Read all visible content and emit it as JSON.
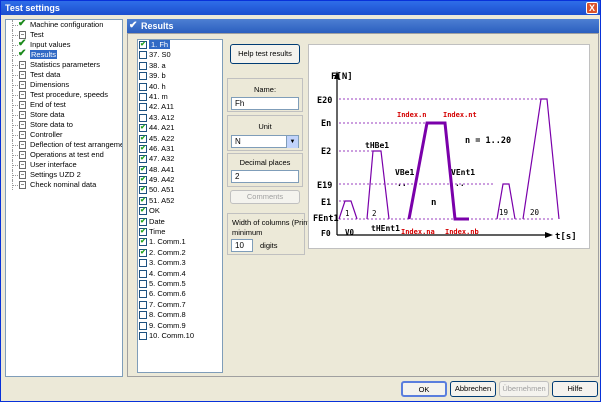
{
  "window": {
    "title": "Test settings",
    "close_glyph": "X"
  },
  "tree": {
    "items": [
      {
        "label": "Machine configuration",
        "checked": true
      },
      {
        "label": "Test",
        "checked": false
      },
      {
        "label": "Input values",
        "checked": true
      },
      {
        "label": "Results",
        "checked": true,
        "selected": true
      },
      {
        "label": "Statistics parameters",
        "checked": false
      },
      {
        "label": "Test data",
        "checked": false
      },
      {
        "label": "Dimensions",
        "checked": false
      },
      {
        "label": "Test procedure, speeds",
        "checked": false
      },
      {
        "label": "End of test",
        "checked": false
      },
      {
        "label": "Store data",
        "checked": false
      },
      {
        "label": "Store data to",
        "checked": false
      },
      {
        "label": "Controller",
        "checked": false
      },
      {
        "label": "Deflection of test arrangement",
        "checked": false
      },
      {
        "label": "Operations at test end",
        "checked": false
      },
      {
        "label": "User interface",
        "checked": false
      },
      {
        "label": "Settings UZD 2",
        "checked": false
      },
      {
        "label": "Check nominal data",
        "checked": false
      }
    ]
  },
  "results_header": {
    "title": "Results"
  },
  "result_list": {
    "items": [
      {
        "label": "1. Fh",
        "checked": true,
        "selected": true
      },
      {
        "label": "37. S0",
        "checked": false
      },
      {
        "label": "38. a",
        "checked": false
      },
      {
        "label": "39. b",
        "checked": false
      },
      {
        "label": "40. h",
        "checked": false
      },
      {
        "label": "41. m",
        "checked": false
      },
      {
        "label": "42. A11",
        "checked": false
      },
      {
        "label": "43. A12",
        "checked": false
      },
      {
        "label": "44. A21",
        "checked": true
      },
      {
        "label": "45. A22",
        "checked": true
      },
      {
        "label": "46. A31",
        "checked": true
      },
      {
        "label": "47. A32",
        "checked": true
      },
      {
        "label": "48. A41",
        "checked": true
      },
      {
        "label": "49. A42",
        "checked": true
      },
      {
        "label": "50. A51",
        "checked": true
      },
      {
        "label": "51. A52",
        "checked": true
      },
      {
        "label": "OK",
        "checked": true
      },
      {
        "label": "Date",
        "checked": true
      },
      {
        "label": "Time",
        "checked": true
      },
      {
        "label": "1. Comm.1",
        "checked": true
      },
      {
        "label": "2. Comm.2",
        "checked": true
      },
      {
        "label": "3. Comm.3",
        "checked": false
      },
      {
        "label": "4. Comm.4",
        "checked": false
      },
      {
        "label": "5. Comm.5",
        "checked": false
      },
      {
        "label": "6. Comm.6",
        "checked": false
      },
      {
        "label": "7. Comm.7",
        "checked": false
      },
      {
        "label": "8. Comm.8",
        "checked": false
      },
      {
        "label": "9. Comm.9",
        "checked": false
      },
      {
        "label": "10. Comm.10",
        "checked": false
      }
    ]
  },
  "controls": {
    "help_button": "Help test results",
    "name_label": "Name:",
    "name_value": "Fh",
    "unit_label": "Unit",
    "unit_value": "N",
    "decimal_label": "Decimal places",
    "decimal_value": "2",
    "comments_button": "Comments",
    "width_label": "Width of columns (Print)",
    "minimum_label": "minimum",
    "width_value": "10",
    "digits_label": "digits"
  },
  "diagram": {
    "y_axis": "F[N]",
    "x_axis": "t[s]",
    "y_ticks": [
      "E20",
      "En",
      "E2",
      "E19",
      "E1",
      "FEnt1",
      "F0"
    ],
    "labels": {
      "v0": "V0",
      "seg1": "1",
      "seg2": "2",
      "segn": "n",
      "seg19": "19",
      "seg20": "20",
      "thbe1": "tHBe1",
      "thent1": "tHEnt1",
      "vbe1": "VBe1",
      "vent1": "VEnt1",
      "dots1": "..",
      "dots2": "..",
      "n_range": "n = 1..20",
      "index_n": "Index.n",
      "index_nt": "Index.nt",
      "index_na": "Index.na",
      "index_nb": "Index.nb"
    }
  },
  "bottom_buttons": {
    "ok": "OK",
    "cancel": "Abbrechen",
    "apply": "Übernehmen",
    "help": "Hilfe"
  }
}
